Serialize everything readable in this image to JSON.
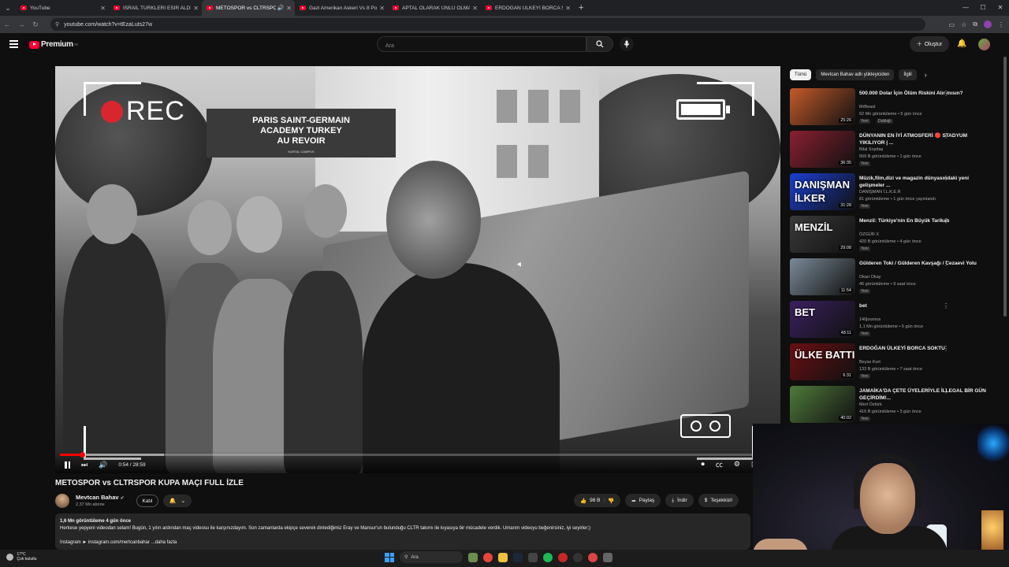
{
  "browser": {
    "tabs": [
      {
        "title": "YouTube",
        "active": false,
        "audio": false
      },
      {
        "title": "İSRAİL TÜRKLERİ ESİR ALDI - Yo",
        "active": false,
        "audio": false
      },
      {
        "title": "METOSPOR vs CLTRSPOR K",
        "active": true,
        "audio": true
      },
      {
        "title": "Gazi Amerikan Askeri Vs 8 Poli",
        "active": false,
        "audio": false
      },
      {
        "title": "APTAL OLARAK ÜNLÜ OLMAK",
        "active": false,
        "audio": false
      },
      {
        "title": "ERDOĞAN ÜLKEYİ BORCA SOK",
        "active": false,
        "audio": false
      }
    ],
    "url": "youtube.com/watch?v=tEzaLuts27w"
  },
  "header": {
    "logo_text": "Premium",
    "logo_sup": "TR",
    "search_placeholder": "Ara",
    "create_label": "Oluştur"
  },
  "player": {
    "overlay_rec": "REC",
    "sign_line1": "PARIS SAINT-GERMAIN",
    "sign_line2": "ACADEMY TURKEY",
    "sign_line3": "AU REVOIR",
    "sign_small": "KARTAL CAMPUS",
    "time": "0:54 / 28:59",
    "progress_played": 0.031,
    "progress_buffered": 0.145
  },
  "video": {
    "title": "METOSPOR vs CLTRSPOR KUPA MAÇI FULL İZLE",
    "channel": "Mevtcan Bahav",
    "subscribers": "2,37 Mn abone",
    "join_label": "Katıl",
    "likes": "98 B",
    "share_label": "Paylaş",
    "download_label": "İndir",
    "thanks_label": "Teşekkürl"
  },
  "description": {
    "meta": "1,6 Mn görüntüleme  4 gün önce",
    "text": "Herkese yepyeni videodan selam! Bugün, 1 yılın ardından maç videosu ile karşınızdayım. Son zamanlarda ekipçe severek dinlediğimiz Eray ve Mansur'un bulunduğu CLTR takımı ile kıyasıya bir mücadele verdik. Umarım videoyu beğenirsiniz, iyi seyirler;)",
    "more": "Instagram ► instagram.com/mertcanbahar  ...daha fazla"
  },
  "sidebar": {
    "chips": [
      "Tümü",
      "Mevtcan Bahav adlı yükleyiciden",
      "İlgili"
    ],
    "items": [
      {
        "title": "500.000 Dolar İçin Ölüm Riskini Alır mısın?",
        "channel": "MrBeast",
        "meta": "62 Mn görüntüleme • 5 gün önce",
        "badge": "Yeni",
        "badge2": "Dublajlı",
        "duration": "25:26",
        "thumb_text": "",
        "thumb_color": "#c45a2a"
      },
      {
        "title": "DÜNYANIN EN İYİ ATMOSFERİ 🔴 STADYUM YIKILIYOR | ...",
        "channel": "Bilal Soydaş",
        "meta": "569 B görüntüleme • 1 gün önce",
        "badge": "Yeni",
        "badge2": "",
        "duration": "36:35",
        "thumb_text": "",
        "thumb_color": "#8a2030"
      },
      {
        "title": "Müzik,film,dizi ve magazin dünyasındaki yeni gelişmeler ...",
        "channel": "DANIŞMAN İ.L.K.E.R",
        "meta": "81 görüntüleme • 1 gün önce yayınlandı",
        "badge": "Yeni",
        "badge2": "",
        "duration": "31:28",
        "thumb_text": "DANIŞMAN İLKER",
        "thumb_color": "#1b3fd1"
      },
      {
        "title": "Menzil: Türkiye'nin En Büyük Tarikatı",
        "channel": "ÖZGÜR X",
        "meta": "420 B görüntüleme • 4 gün önce",
        "badge": "Yeni",
        "badge2": "",
        "duration": "29:08",
        "thumb_text": "MENZİL",
        "thumb_color": "#3b3b3b"
      },
      {
        "title": "Gülderen Toki / Gülderen Kavşağı / Cezaevi Yolu",
        "channel": "Okan Okay",
        "meta": "46 görüntüleme • 9 saat önce",
        "badge": "Yeni",
        "badge2": "",
        "duration": "11:54",
        "thumb_text": "",
        "thumb_color": "#7a8a98"
      },
      {
        "title": "bet",
        "channel": "140journos",
        "meta": "1,1 Mn görüntüleme • 6 gün önce",
        "badge": "Yeni",
        "badge2": "",
        "duration": "48:11",
        "thumb_text": "BET",
        "thumb_color": "#3a2060"
      },
      {
        "title": "ERDOĞAN ÜLKEYİ BORCA SOKTU",
        "channel": "Beyaz Kurt",
        "meta": "133 B görüntüleme • 7 saat önce",
        "badge": "Yeni",
        "badge2": "",
        "duration": "6:31",
        "thumb_text": "ÜLKE BATTI",
        "thumb_color": "#6a0f12"
      },
      {
        "title": "JAMAİKA'DA ÇETE ÜYELERİYLE İLLEGAL BİR GÜN GEÇİRDİM!...",
        "channel": "Mert Öztürk",
        "meta": "416 B görüntüleme • 3 gün önce",
        "badge": "Yeni",
        "badge2": "",
        "duration": "40:02",
        "thumb_text": "",
        "thumb_color": "#4f7a3a"
      }
    ]
  },
  "taskbar": {
    "temp": "17°C",
    "weather": "Çok bulutlu",
    "search_label": "Ara"
  }
}
